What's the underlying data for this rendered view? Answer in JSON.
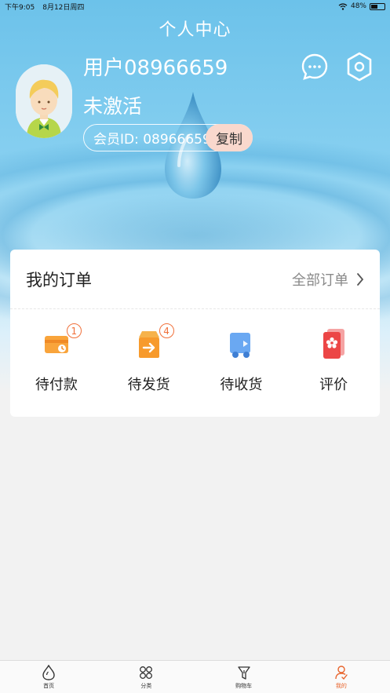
{
  "status_bar": {
    "time": "下午9:05",
    "date": "8月12日周四",
    "battery": "48%"
  },
  "header": {
    "title": "个人中心"
  },
  "profile": {
    "username": "用户08966659",
    "activation_status": "未激活",
    "member_id_label": "会员ID: 08966659",
    "copy_label": "复制"
  },
  "orders": {
    "title": "我的订单",
    "all_orders_label": "全部订单",
    "items": [
      {
        "label": "待付款",
        "badge": "1",
        "icon": "wallet-icon"
      },
      {
        "label": "待发货",
        "badge": "4",
        "icon": "box-arrow-icon"
      },
      {
        "label": "待收货",
        "badge": "",
        "icon": "truck-icon"
      },
      {
        "label": "评价",
        "badge": "",
        "icon": "flower-card-icon"
      }
    ]
  },
  "tabbar": {
    "items": [
      {
        "label": "首页",
        "icon": "drop-icon"
      },
      {
        "label": "分类",
        "icon": "grid-icon"
      },
      {
        "label": "购物车",
        "icon": "filter-cart-icon"
      },
      {
        "label": "我的",
        "icon": "user-icon",
        "active": true
      }
    ]
  },
  "colors": {
    "accent": "#e8642c",
    "badge": "#f0703a",
    "copy_button_bg": "#f9d8cd",
    "header_top": "#6cc2ea"
  }
}
